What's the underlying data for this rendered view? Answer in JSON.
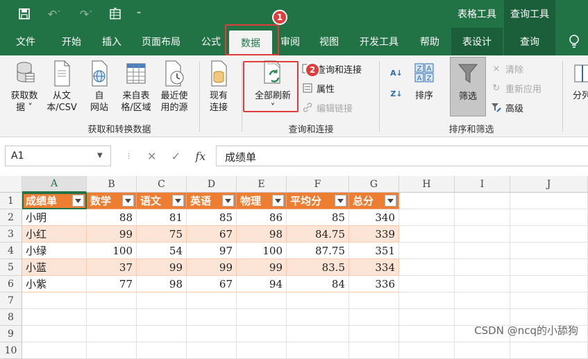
{
  "titlebar": {
    "context_groups": [
      {
        "label": "表格工具"
      },
      {
        "label": "查询工具"
      }
    ]
  },
  "tabs": [
    {
      "label": "文件"
    },
    {
      "label": "开始"
    },
    {
      "label": "插入"
    },
    {
      "label": "页面布局"
    },
    {
      "label": "公式"
    },
    {
      "label": "数据"
    },
    {
      "label": "审阅"
    },
    {
      "label": "视图"
    },
    {
      "label": "开发工具"
    },
    {
      "label": "帮助"
    },
    {
      "label": "表设计"
    },
    {
      "label": "查询"
    }
  ],
  "annotations": {
    "step1": "1",
    "step2": "2"
  },
  "ribbon": {
    "get_transform": {
      "buttons": [
        {
          "line1": "获取数",
          "line2": "据 ˅"
        },
        {
          "line1": "从文",
          "line2": "本/CSV"
        },
        {
          "line1": "自",
          "line2": "网站"
        },
        {
          "line1": "来自表",
          "line2": "格/区域"
        },
        {
          "line1": "最近使",
          "line2": "用的源"
        },
        {
          "line1": "现有",
          "line2": "连接"
        }
      ],
      "group_label": "获取和转换数据"
    },
    "queries": {
      "refresh_all": {
        "line1": "全部刷新",
        "line2": "˅"
      },
      "items": [
        {
          "label": "查询和连接"
        },
        {
          "label": "属性"
        },
        {
          "label": "编辑链接"
        }
      ],
      "group_label": "查询和连接"
    },
    "sort_filter": {
      "sort_label": "排序",
      "filter_label": "筛选",
      "items": [
        {
          "label": "清除"
        },
        {
          "label": "重新应用"
        },
        {
          "label": "高级"
        }
      ],
      "group_label": "排序和筛选"
    },
    "split_label": "分列"
  },
  "formula_bar": {
    "name_box": "A1",
    "fx": "fx",
    "value": "成绩单"
  },
  "sheet": {
    "columns": [
      "A",
      "B",
      "C",
      "D",
      "E",
      "F",
      "G",
      "H",
      "I",
      "J"
    ],
    "rows": [
      "1",
      "2",
      "3",
      "4",
      "5",
      "6",
      "7",
      "8",
      "9",
      "10"
    ],
    "table_headers": [
      "成绩单",
      "数学",
      "语文",
      "英语",
      "物理",
      "平均分",
      "总分"
    ],
    "table_rows": [
      [
        "小明",
        "88",
        "81",
        "85",
        "86",
        "85",
        "340"
      ],
      [
        "小红",
        "99",
        "75",
        "67",
        "98",
        "84.75",
        "339"
      ],
      [
        "小绿",
        "100",
        "54",
        "97",
        "100",
        "87.75",
        "351"
      ],
      [
        "小蓝",
        "37",
        "99",
        "99",
        "99",
        "83.5",
        "334"
      ],
      [
        "小紫",
        "77",
        "98",
        "67",
        "94",
        "84",
        "336"
      ]
    ]
  },
  "watermark": "CSDN @ncq的小舔狗"
}
